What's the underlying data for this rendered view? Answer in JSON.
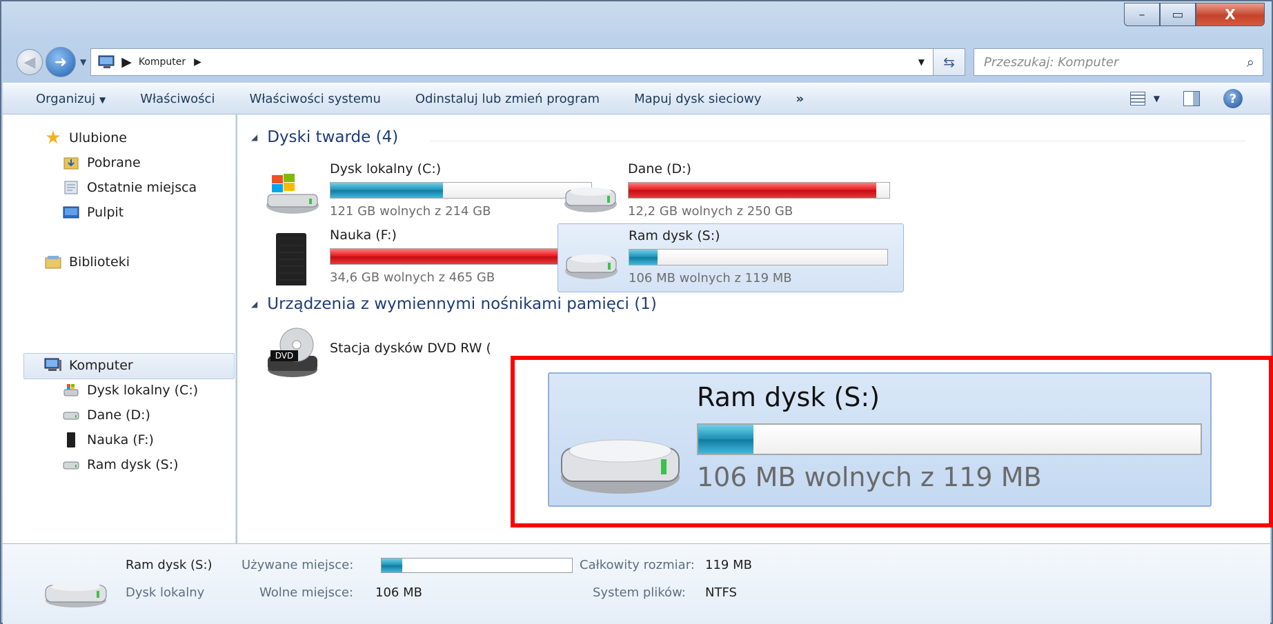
{
  "window": {
    "caption_min": "–",
    "caption_max": "▭",
    "caption_close": "X"
  },
  "address": {
    "crumb": "Komputer",
    "search_placeholder": "Przeszukaj: Komputer"
  },
  "commands": [
    "Organizuj",
    "Właściwości",
    "Właściwości systemu",
    "Odinstaluj lub zmień program",
    "Mapuj dysk sieciowy",
    "»"
  ],
  "nav": {
    "favorites": "Ulubione",
    "downloads": "Pobrane",
    "recent": "Ostatnie miejsca",
    "desktop": "Pulpit",
    "libraries": "Biblioteki",
    "computer": "Komputer",
    "drive_c": "Dysk lokalny (C:)",
    "drive_d": "Dane (D:)",
    "drive_f": "Nauka (F:)",
    "drive_s": "Ram dysk (S:)"
  },
  "groups": {
    "hard_disks": "Dyski twarde (4)",
    "removable": "Urządzenia z wymiennymi nośnikami pamięci (1)"
  },
  "drives": [
    {
      "name": "Dysk lokalny (C:)",
      "free": "121 GB wolnych z 214 GB",
      "used_fraction": 0.43,
      "color": "blue"
    },
    {
      "name": "Dane (D:)",
      "free": "12,2 GB wolnych z 250 GB",
      "used_fraction": 0.95,
      "color": "red"
    },
    {
      "name": "Nauka (F:)",
      "free": "34,6 GB wolnych z 465 GB",
      "used_fraction": 0.93,
      "color": "red"
    },
    {
      "name": "Ram dysk (S:)",
      "free": "106 MB wolnych z 119 MB",
      "used_fraction": 0.11,
      "color": "blue"
    }
  ],
  "dvd": {
    "name": "Stacja dysków DVD RW (",
    "badge": "DVD"
  },
  "details": {
    "name": "Ram dysk (S:)",
    "type": "Dysk lokalny",
    "used_label": "Używane miejsce:",
    "free_label": "Wolne miejsce:",
    "free_value": "106 MB",
    "total_label": "Całkowity rozmiar:",
    "total_value": "119 MB",
    "fs_label": "System plików:",
    "fs_value": "NTFS",
    "used_fraction": 0.11
  },
  "zoom": {
    "name": "Ram dysk (S:)",
    "free": "106 MB wolnych z 119 MB",
    "used_fraction": 0.11,
    "frame_color": "#ff0000"
  }
}
